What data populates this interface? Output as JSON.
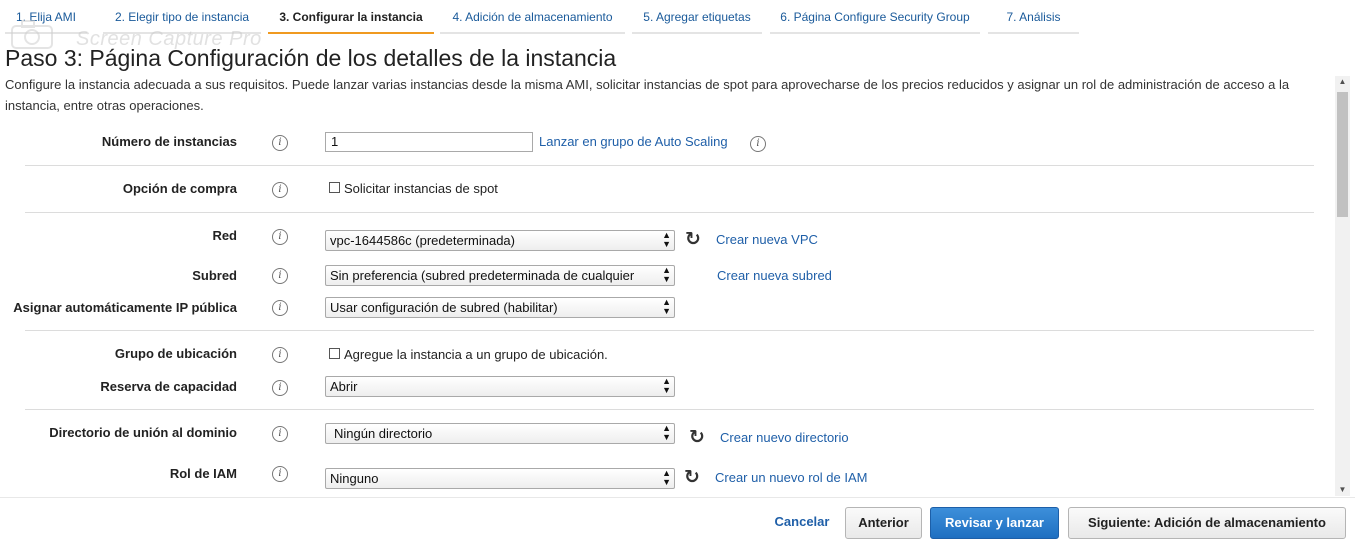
{
  "wizard_tabs": [
    {
      "label": "1. Elija AMI",
      "active": false
    },
    {
      "label": "2. Elegir tipo de instancia",
      "active": false
    },
    {
      "label": "3. Configurar la instancia",
      "active": true
    },
    {
      "label": "4. Adición de almacenamiento",
      "active": false
    },
    {
      "label": "5. Agregar etiquetas",
      "active": false
    },
    {
      "label": "6. Página Configure Security Group",
      "active": false
    },
    {
      "label": "7. Análisis",
      "active": false
    }
  ],
  "watermark": {
    "text": "Screen Capture Pro"
  },
  "header": {
    "title": "Paso 3: Página Configuración de los detalles de la instancia",
    "description": "Configure la instancia adecuada a sus requisitos. Puede lanzar varias instancias desde la misma AMI, solicitar instancias de spot para aprovecharse de los precios reducidos y asignar un rol de administración de acceso a la instancia, entre otras operaciones."
  },
  "info_icon": "i",
  "form": {
    "instances": {
      "label": "Número de instancias",
      "value": "1",
      "link": "Lanzar en grupo de Auto Scaling"
    },
    "purchase_option": {
      "label": "Opción de compra",
      "checkbox_label": "Solicitar instancias de spot",
      "checked": false
    },
    "network": {
      "label": "Red",
      "value": "vpc-1644586c (predeterminada)",
      "link": "Crear nueva VPC"
    },
    "subnet": {
      "label": "Subred",
      "value": "Sin preferencia (subred predeterminada de cualquier",
      "link": "Crear nueva subred"
    },
    "public_ip": {
      "label": "Asignar automáticamente IP pública",
      "value": "Usar configuración de subred (habilitar)"
    },
    "placement_group": {
      "label": "Grupo de ubicación",
      "checkbox_label": "Agregue la instancia a un grupo de ubicación.",
      "checked": false
    },
    "capacity_reservation": {
      "label": "Reserva de capacidad",
      "value": "Abrir"
    },
    "domain_directory": {
      "label": "Directorio de unión al dominio",
      "value": "Ningún directorio",
      "link": "Crear nuevo directorio"
    },
    "iam_role": {
      "label": "Rol de IAM",
      "value": "Ninguno",
      "link": "Crear un nuevo rol de IAM"
    }
  },
  "footer": {
    "cancel": "Cancelar",
    "previous": "Anterior",
    "review_launch": "Revisar y lanzar",
    "next": "Siguiente: Adición de almacenamiento"
  },
  "colors": {
    "accent_tab": "#f09a20",
    "link": "#1f5fa8",
    "primary": "#2a7bcc"
  },
  "icons": [
    "info-icon",
    "refresh-icon",
    "dropdown-arrow-icon",
    "scroll-up-icon",
    "scroll-down-icon"
  ]
}
